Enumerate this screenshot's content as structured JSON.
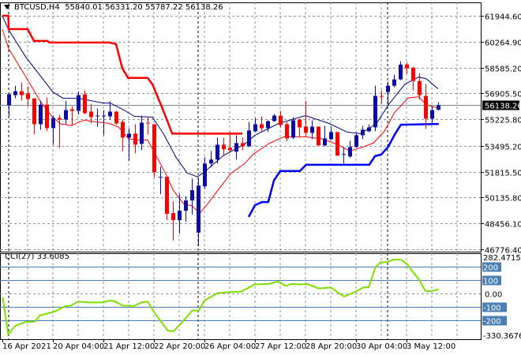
{
  "header": {
    "symbol": "BTCUSD,H4",
    "open": "55840.01",
    "high": "56331.20",
    "low": "55787.22",
    "close": "56138.26"
  },
  "current_price_label": "56138.26",
  "colors": {
    "bull": "#0c0ca4",
    "bear": "#ff0000",
    "ma_fast": "#ff0000",
    "ma_slow": "#000080",
    "upper_step": "#ff0000",
    "lower_step": "#0000ff",
    "cci": "#7ee000",
    "grid": "#8894a0",
    "level": "#4a7eb4"
  },
  "chart_data": [
    {
      "type": "candlestick",
      "title": "BTCUSD,H4",
      "ylim": [
        46776.4,
        61944.6
      ],
      "y_ticks": [
        "61944.60",
        "60264.90",
        "58585.20",
        "56905.50",
        "55225.80",
        "53495.20",
        "51815.50",
        "50135.80",
        "48456.10",
        "46776.40"
      ],
      "x_tick_labels": [
        "16 Apr 2021",
        "20 Apr 04:00",
        "21 Apr 12:00",
        "22 Apr 20:00",
        "26 Apr 04:00",
        "27 Apr 12:00",
        "28 Apr 20:00",
        "30 Apr 04:00",
        "3 May 12:00"
      ],
      "grid": true,
      "ohlc": [
        [
          56125,
          56891,
          55411,
          56840
        ],
        [
          56789,
          57402,
          56585,
          57044
        ],
        [
          57044,
          57606,
          56432,
          56789
        ],
        [
          56891,
          57350,
          56074,
          56534
        ],
        [
          56585,
          56585,
          54236,
          54900
        ],
        [
          54900,
          56432,
          54543,
          56176
        ],
        [
          56176,
          56636,
          54441,
          54645
        ],
        [
          54645,
          55462,
          53573,
          55308
        ],
        [
          55308,
          55513,
          53369,
          55206
        ],
        [
          55206,
          56432,
          54900,
          55819
        ],
        [
          55870,
          56074,
          54798,
          55768
        ],
        [
          55768,
          57044,
          55513,
          56789
        ],
        [
          56840,
          57095,
          55564,
          55615
        ],
        [
          55717,
          56227,
          54951,
          55360
        ],
        [
          55411,
          55921,
          54747,
          55462
        ],
        [
          55411,
          55819,
          54185,
          55462
        ],
        [
          55411,
          56381,
          55206,
          55717
        ],
        [
          55717,
          55768,
          54849,
          54951
        ],
        [
          55053,
          55206,
          53164,
          54032
        ],
        [
          54032,
          54645,
          52501,
          54287
        ],
        [
          54287,
          54900,
          53011,
          53573
        ],
        [
          53624,
          55462,
          53215,
          55002
        ],
        [
          55002,
          55411,
          54236,
          54951
        ],
        [
          54900,
          54900,
          51429,
          51786
        ],
        [
          51429,
          52143,
          50357,
          51480
        ],
        [
          51480,
          51480,
          48672,
          49080
        ],
        [
          49131,
          49897,
          47345,
          48672
        ],
        [
          48672,
          50357,
          47804,
          49285
        ],
        [
          49285,
          50203,
          48570,
          49948
        ],
        [
          49948,
          51378,
          49029,
          50612
        ],
        [
          47855,
          51378,
          46987,
          50918
        ],
        [
          50867,
          52756,
          50714,
          52348
        ],
        [
          52348,
          53164,
          52092,
          52603
        ],
        [
          52603,
          54032,
          52348,
          53573
        ],
        [
          53573,
          54032,
          52909,
          53266
        ],
        [
          53369,
          54390,
          53113,
          53215
        ],
        [
          53113,
          54185,
          52603,
          53675
        ],
        [
          53675,
          54032,
          53215,
          53471
        ],
        [
          53471,
          55053,
          53420,
          54492
        ],
        [
          54441,
          55308,
          54390,
          54900
        ],
        [
          54900,
          55411,
          54441,
          54645
        ],
        [
          54645,
          55155,
          54390,
          55104
        ],
        [
          55104,
          55564,
          55053,
          55462
        ],
        [
          55462,
          55768,
          54696,
          54849
        ],
        [
          54900,
          55053,
          53777,
          53981
        ],
        [
          54032,
          55360,
          53930,
          55155
        ],
        [
          55206,
          55257,
          54032,
          54696
        ],
        [
          54747,
          56432,
          54134,
          54339
        ],
        [
          54339,
          55155,
          53930,
          54747
        ],
        [
          54747,
          54747,
          53522,
          53522
        ],
        [
          53522,
          54798,
          53471,
          53981
        ],
        [
          53930,
          54747,
          53879,
          54390
        ],
        [
          54390,
          54390,
          52858,
          52858
        ],
        [
          52909,
          53420,
          52348,
          52960
        ],
        [
          52807,
          53828,
          52705,
          53420
        ],
        [
          53420,
          54339,
          53369,
          54185
        ],
        [
          54185,
          54798,
          53930,
          54543
        ],
        [
          54441,
          54900,
          54390,
          54696
        ],
        [
          54696,
          57402,
          54441,
          56738
        ],
        [
          56738,
          57095,
          56227,
          56687
        ],
        [
          56993,
          57657,
          56176,
          57402
        ],
        [
          57402,
          58116,
          57299,
          57810
        ],
        [
          57810,
          58984,
          57759,
          58780
        ],
        [
          58780,
          58933,
          58167,
          58525
        ],
        [
          58576,
          58627,
          57095,
          57708
        ],
        [
          57708,
          58218,
          56534,
          56789
        ],
        [
          56738,
          57504,
          54594,
          55257
        ],
        [
          55257,
          56074,
          55002,
          55819
        ],
        [
          55840.01,
          56331.2,
          55787.22,
          56138.26
        ]
      ],
      "overlays": [
        {
          "name": "ma_slow",
          "points": [
            [
              0,
              61945
            ],
            [
              1,
              61026
            ],
            [
              3.75,
              59239
            ],
            [
              8,
              56993
            ],
            [
              9.6,
              56585
            ],
            [
              12.1,
              56585
            ],
            [
              15.9,
              56278
            ],
            [
              17.1,
              56278
            ],
            [
              19.25,
              55819
            ],
            [
              20.9,
              55411
            ],
            [
              23.75,
              55360
            ],
            [
              25.5,
              54287
            ],
            [
              27.5,
              52756
            ],
            [
              29.25,
              51735
            ],
            [
              30.9,
              51480
            ],
            [
              32.1,
              51837
            ],
            [
              35,
              52858
            ],
            [
              38.4,
              53624
            ],
            [
              40,
              54185
            ],
            [
              43.75,
              54951
            ],
            [
              48,
              55462
            ],
            [
              51.75,
              54951
            ],
            [
              54.6,
              54390
            ],
            [
              56.75,
              54287
            ],
            [
              59.25,
              54951
            ],
            [
              61.25,
              56227
            ],
            [
              63.75,
              57504
            ],
            [
              65.9,
              57963
            ],
            [
              67.1,
              57861
            ],
            [
              69,
              57198
            ]
          ]
        },
        {
          "name": "ma_fast",
          "points": [
            [
              0,
              61077
            ],
            [
              1,
              59801
            ],
            [
              3.75,
              57964
            ],
            [
              6.1,
              56330
            ],
            [
              8,
              55330
            ],
            [
              9.25,
              54921
            ],
            [
              10.9,
              54819
            ],
            [
              13,
              55176
            ],
            [
              14.25,
              55075
            ],
            [
              16.75,
              54972
            ],
            [
              18.4,
              54717
            ],
            [
              20,
              53951
            ],
            [
              21.25,
              53879
            ],
            [
              23,
              53879
            ],
            [
              24.25,
              52930
            ],
            [
              25.9,
              51654
            ],
            [
              27.1,
              50582
            ],
            [
              28.75,
              49714
            ],
            [
              30,
              49612
            ],
            [
              31.25,
              49101
            ],
            [
              32.5,
              49714
            ],
            [
              34.6,
              50868
            ],
            [
              36.25,
              51735
            ],
            [
              38.4,
              52348
            ],
            [
              39.6,
              52910
            ],
            [
              42.1,
              53624
            ],
            [
              44.6,
              54083
            ],
            [
              48,
              54083
            ],
            [
              50.9,
              53930
            ],
            [
              53.4,
              53522
            ],
            [
              55,
              53165
            ],
            [
              56.75,
              53369
            ],
            [
              58.75,
              53675
            ],
            [
              60.5,
              54441
            ],
            [
              62.1,
              55666
            ],
            [
              64.25,
              56606
            ],
            [
              65.9,
              56687
            ],
            [
              67.1,
              56176
            ],
            [
              69,
              55942
            ]
          ]
        },
        {
          "name": "upper_step",
          "points": [
            [
              0,
              61945
            ],
            [
              0.95,
              61945
            ],
            [
              1,
              61077
            ],
            [
              4,
              61077
            ],
            [
              5,
              60311
            ],
            [
              7.1,
              60311
            ],
            [
              7.5,
              60209
            ],
            [
              16.9,
              60209
            ],
            [
              18,
              60107
            ],
            [
              19,
              58525
            ],
            [
              19.9,
              57912
            ],
            [
              23,
              57912
            ],
            [
              23.75,
              57504
            ],
            [
              25.25,
              56024
            ],
            [
              26.9,
              54288
            ],
            [
              38,
              54288
            ]
          ]
        },
        {
          "name": "lower_step",
          "points": [
            [
              39,
              48876
            ],
            [
              40,
              49642
            ],
            [
              41.1,
              49846
            ],
            [
              42.1,
              49846
            ],
            [
              43,
              51246
            ],
            [
              44,
              51858
            ],
            [
              47.1,
              51858
            ],
            [
              48.1,
              52266
            ],
            [
              58.1,
              52266
            ],
            [
              59,
              52828
            ],
            [
              60,
              52930
            ],
            [
              61.1,
              53441
            ],
            [
              62.1,
              54207
            ],
            [
              63.1,
              54870
            ],
            [
              69.1,
              54921
            ]
          ]
        }
      ]
    },
    {
      "type": "line",
      "title": "CCI(27) 33.6085",
      "indicator": "CCI(27)",
      "current_value": "33.6085",
      "ylim": [
        -330.3676,
        282.4715
      ],
      "y_tick_top": "282.4715",
      "y_tick_bottom": "-330.3676",
      "zero_label": "0.00",
      "levels": [
        200,
        100,
        -100,
        -200
      ],
      "level_labels": [
        "200",
        "100",
        "-100",
        "-200"
      ],
      "points": [
        [
          0.05,
          -25
        ],
        [
          0.94,
          -304
        ],
        [
          1.99,
          -241
        ],
        [
          3.6,
          -212
        ],
        [
          5.15,
          -208
        ],
        [
          5.9,
          -163
        ],
        [
          8.3,
          -133
        ],
        [
          9.9,
          -94
        ],
        [
          10.9,
          -88
        ],
        [
          12,
          -59
        ],
        [
          13.6,
          -65
        ],
        [
          15.9,
          -65
        ],
        [
          17,
          -51
        ],
        [
          17.8,
          -57
        ],
        [
          19.1,
          -90
        ],
        [
          20.9,
          -90
        ],
        [
          22,
          -65
        ],
        [
          23,
          -59
        ],
        [
          24.1,
          -143
        ],
        [
          26.2,
          -276
        ],
        [
          27.1,
          -280
        ],
        [
          28.3,
          -222
        ],
        [
          30.1,
          -124
        ],
        [
          31.1,
          -127
        ],
        [
          32,
          -51
        ],
        [
          34.1,
          4
        ],
        [
          36.5,
          14
        ],
        [
          37.8,
          14
        ],
        [
          39.9,
          69
        ],
        [
          42.2,
          73
        ],
        [
          43.6,
          92
        ],
        [
          44.9,
          59
        ],
        [
          45.8,
          73
        ],
        [
          47,
          69
        ],
        [
          48.3,
          73
        ],
        [
          50.1,
          39
        ],
        [
          52,
          47
        ],
        [
          54.1,
          -22
        ],
        [
          55.9,
          14
        ],
        [
          57.2,
          47
        ],
        [
          58,
          47
        ],
        [
          59.1,
          200
        ],
        [
          59.9,
          235
        ],
        [
          60.9,
          235
        ],
        [
          62,
          255
        ],
        [
          63.1,
          253
        ],
        [
          64.1,
          220
        ],
        [
          65.1,
          155
        ],
        [
          65.9,
          112
        ],
        [
          67,
          20
        ],
        [
          68,
          20
        ],
        [
          69.1,
          33
        ]
      ]
    }
  ]
}
